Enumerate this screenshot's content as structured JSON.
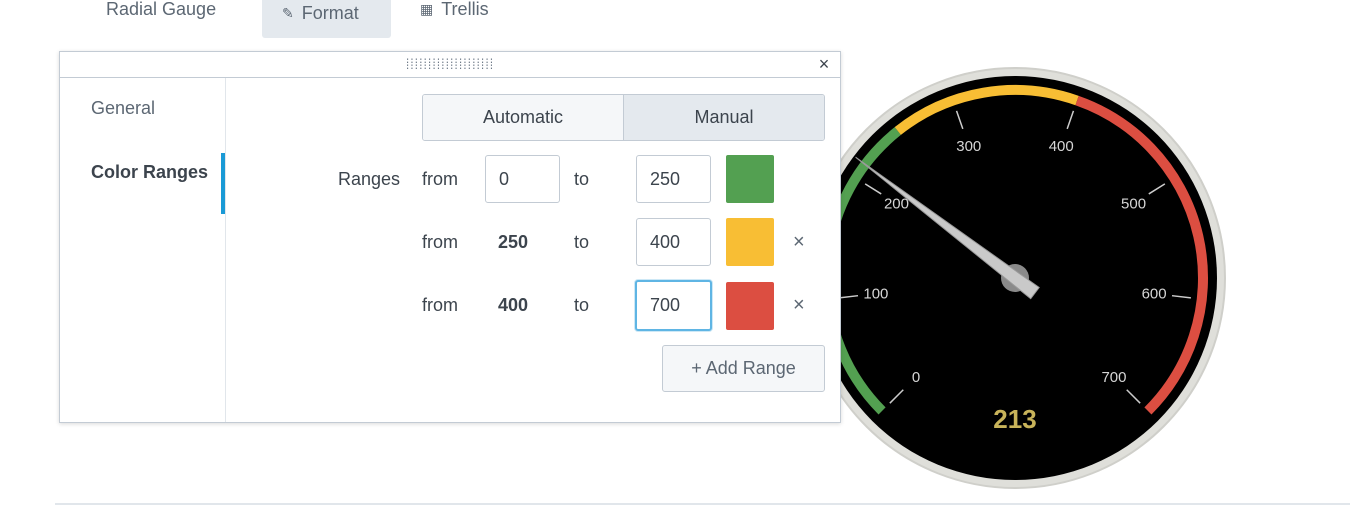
{
  "topbar": {
    "radial_label": "Radial Gauge",
    "format_label": "Format",
    "trellis_label": "Trellis"
  },
  "gauge": {
    "value": "213",
    "ticks": [
      "0",
      "100",
      "200",
      "300",
      "400",
      "500",
      "600",
      "700"
    ],
    "min": 0,
    "max": 700,
    "colors": {
      "green": "#53a051",
      "yellow": "#f8be34",
      "red": "#dc4e41"
    }
  },
  "popover": {
    "sidebar": {
      "general": "General",
      "color_ranges": "Color Ranges"
    },
    "mode": {
      "automatic": "Automatic",
      "manual": "Manual",
      "selected": "Manual"
    },
    "ranges_label": "Ranges",
    "rows": [
      {
        "from_label": "from",
        "from": "0",
        "to_label": "to",
        "to": "250",
        "color": "#53a051"
      },
      {
        "from_label": "from",
        "from": "250",
        "to_label": "to",
        "to": "400",
        "color": "#f8be34"
      },
      {
        "from_label": "from",
        "from": "400",
        "to_label": "to",
        "to": "700",
        "color": "#dc4e41"
      }
    ],
    "add_range": "+ Add Range",
    "close": "×",
    "remove": "×"
  }
}
